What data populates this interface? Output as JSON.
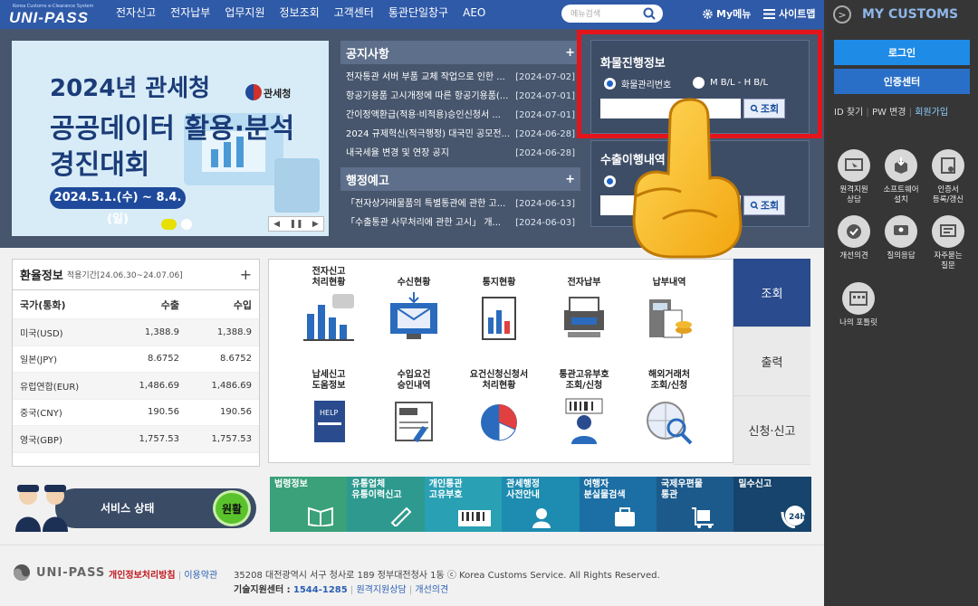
{
  "header": {
    "logo_sub": "Korea Customs e-Clearance System",
    "logo": "UNI-PASS",
    "menu": [
      "전자신고",
      "전자납부",
      "업무지원",
      "정보조회",
      "고객센터",
      "통관단일창구",
      "AEO"
    ],
    "search_placeholder": "메뉴검색",
    "my_menu": "My메뉴",
    "sitemap": "사이트맵"
  },
  "banner": {
    "line1": "2024년 관세청",
    "line2": "공공데이터 활용·분석",
    "line3": "경진대회",
    "date": "2024.5.1.(수) ~ 8.4.(일)",
    "agency": "관세청"
  },
  "notices": {
    "title": "공지사항",
    "items": [
      {
        "title": "전자통관 서버 부품 교체 작업으로 인한 ...",
        "date": "[2024-07-02]"
      },
      {
        "title": "항공기용품 고시개정에 따른 항공기용품(...",
        "date": "[2024-07-01]"
      },
      {
        "title": "간이정액환급(적용·비적용)승인신청서 ...",
        "date": "[2024-07-01]"
      },
      {
        "title": "2024 규제혁신(적극행정) 대국민 공모전...",
        "date": "[2024-06-28]"
      },
      {
        "title": "내국세율 변경 및 연장 공지",
        "date": "[2024-06-28]"
      }
    ]
  },
  "admin_notice": {
    "title": "행정예고",
    "items": [
      {
        "title": "「전자상거래물품의 특별통관에 관한 고...",
        "date": "[2024-06-13]"
      },
      {
        "title": "「수출통관 사무처리에 관한 고시」 개...",
        "date": "[2024-06-03]"
      }
    ]
  },
  "cargo": {
    "title": "화물진행정보",
    "option1": "화물관리번호",
    "option2": "M B/L - H B/L",
    "query": "조회"
  },
  "export": {
    "title": "수출이행내역",
    "query": "조회"
  },
  "fx": {
    "title": "환율정보",
    "period": "적용기간[24.06.30~24.07.06]",
    "plus": "+",
    "headers": [
      "국가(통화)",
      "수출",
      "수입"
    ],
    "rows": [
      [
        "미국(USD)",
        "1,388.9",
        "1,388.9"
      ],
      [
        "일본(JPY)",
        "8.6752",
        "8.6752"
      ],
      [
        "유럽연합(EUR)",
        "1,486.69",
        "1,486.69"
      ],
      [
        "중국(CNY)",
        "190.56",
        "190.56"
      ],
      [
        "영국(GBP)",
        "1,757.53",
        "1,757.53"
      ]
    ]
  },
  "services": [
    "전자신고\n처리현황",
    "수신현황",
    "통지현황",
    "전자납부",
    "납부내역",
    "납세신고\n도움정보",
    "수입요건\n승인내역",
    "요건신청신청서\n처리현황",
    "통관고유부호\n조회/신청",
    "해외거래처\n조회/신청"
  ],
  "tabs": [
    "조회",
    "출력",
    "신청·신고"
  ],
  "status": {
    "label": "서비스 상태",
    "value": "원활"
  },
  "tiles": [
    {
      "label": "법령정보",
      "color": "#3aa17a"
    },
    {
      "label": "유통업체\n유통이력신고",
      "color": "#2e9a8f"
    },
    {
      "label": "개인통관\n고유부호",
      "color": "#2aa0b4"
    },
    {
      "label": "관세행정\n사전안내",
      "color": "#1d8cb0"
    },
    {
      "label": "여행자\n분실물검색",
      "color": "#1b6fa4"
    },
    {
      "label": "국제우편물\n통관",
      "color": "#1c5a8c"
    },
    {
      "label": "밀수신고",
      "color": "#16446c"
    }
  ],
  "footer": {
    "logo": "UNI-PASS",
    "privacy": "개인정보처리방침",
    "terms": "이용약관",
    "address": "35208 대전광역시 서구 청사로 189 정부대전청사 1동 ⓒ Korea Customs Service. All Rights Reserved.",
    "tech_label": "기술지원센터 :",
    "tech_phone": "1544-1285",
    "remote": "원격지원상담",
    "improve": "개선의견"
  },
  "sidebar": {
    "title": "MY CUSTOMS",
    "login": "로그인",
    "cert": "인증센터",
    "id_find": "ID 찾기",
    "pw_change": "PW 변경",
    "join": "회원가입",
    "icons": [
      "원격지원\n상담",
      "소프트웨어\n설치",
      "인증서\n등록/갱신",
      "개선의견",
      "질의응답",
      "자주묻는\n질문",
      "나의 포틀릿"
    ]
  },
  "colors": {
    "nav": "#2f5aa8",
    "highlight": "#e4141b",
    "status_ok": "#5ac32c"
  }
}
